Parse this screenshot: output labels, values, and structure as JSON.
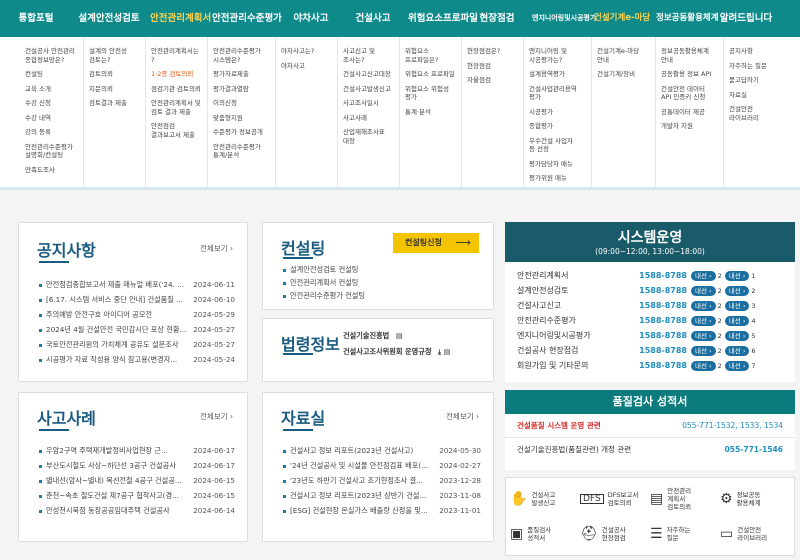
{
  "topnav": [
    "통합포털",
    "설계안전성검토",
    "안전관리계획서",
    "안전관리수준평가",
    "야차사고",
    "건설사고",
    "위험요소프로파일",
    "현장점검",
    "엔지니어링및시공평가",
    "건설기계e-마당",
    "정보공동활용체계",
    "알려드립니다"
  ],
  "mega": [
    [
      "건설공사 안전관리\n종합정보망은?",
      "컨설팅",
      "교육 소개",
      "수강 신청",
      "수강 내역",
      "강의 등록",
      "안전관리수준평가\n설명회/컨설팅",
      "만족도조사"
    ],
    [
      "설계의 안전성\n검토는?",
      "검토의뢰",
      "지문의뢰",
      "검토결과 제출"
    ],
    [
      "안전관리계획서는\n?",
      "1·2종 검토의뢰",
      "점검기관 검토의뢰",
      "안전관리계획서 및\n검토 결과 제출",
      "안전점검\n결과보고서 제출"
    ],
    [
      "안전관리수준평가\n시스템은?",
      "평가자료제출",
      "평가결과열람",
      "이의신청",
      "맞춤형지원",
      "수준평가 정보공개",
      "안전관리수준평가\n통계/분석"
    ],
    [
      "야차사고는?",
      "야차사고"
    ],
    [
      "사고신고 및\n조사는?",
      "건설사고신고대장",
      "건설사고발생신고",
      "사고조사일시",
      "사고사례",
      "산업재해조사표\n대장"
    ],
    [
      "위험요소\n프로파일은?",
      "위험요소 프로파일",
      "위험요소 위험성\n평가",
      "통계·분석"
    ],
    [
      "현장점검은?",
      "현장점검",
      "자율점검"
    ],
    [
      "엔지니어링 및\n시공평가는?",
      "설계용역평가",
      "건설사업관리용역\n평가",
      "시공평가",
      "종합평가",
      "우수건설 사업자\n등 선정",
      "평가담당자 매뉴",
      "평가위원 매뉴"
    ],
    [
      "건설기계e-마당\n안내",
      "건설기계/장비"
    ],
    [
      "정보공동활용체계\n안내",
      "공동활용 정보 API",
      "건설안전 데이터\nAPI 인증키 신청",
      "공통데이터 제공",
      "개발자 지원"
    ],
    [
      "공지사항",
      "자주하는 질문",
      "묻고답하기",
      "자료실",
      "건설안전\n라이브러리"
    ]
  ],
  "notice": {
    "title": "공지사항",
    "more": "전체보기 ›",
    "items": [
      {
        "t": "안전점검종합보고서 제출 매뉴얼 배포('24. ...",
        "d": "2024-06-11"
      },
      {
        "t": "[6.17. 시스템 서비스 중단 안내] 건설품질 ...",
        "d": "2024-06-10"
      },
      {
        "t": "주의예방 안전구호 아이디어 공모전",
        "d": "2024-05-29"
      },
      {
        "t": "2024년 4월 건설안전 국민감시단 포상 현황...",
        "d": "2024-05-27"
      },
      {
        "t": "국토안전관리원의 가치체계 공유도 설문조사",
        "d": "2024-05-27"
      },
      {
        "t": "시공평가 자료 작성용 양식 참고용(변경자...",
        "d": "2024-05-24"
      }
    ]
  },
  "consult": {
    "title": "컨설팅",
    "button": "컨설팅신청",
    "items": [
      "설계안전성검토 컨설팅",
      "안전관리계획서 컨설팅",
      "안전관리수준평가 컨설팅"
    ]
  },
  "law": {
    "title": "법령정보",
    "items": [
      "건설기술진흥법",
      "건설사고조사위원회 운영규정"
    ]
  },
  "cases": {
    "title": "사고사례",
    "more": "전체보기 ›",
    "items": [
      {
        "t": "우암2구역 주택재개발정비사업현장 근...",
        "d": "2024-06-17"
      },
      {
        "t": "부산도시철도 사상~하단선 3공구 건설공사",
        "d": "2024-06-17"
      },
      {
        "t": "별내선(암사~별내) 복선전철 4공구 건설공...",
        "d": "2024-06-15"
      },
      {
        "t": "춘천~속초 철도건설 제7공구 협착사고(경...",
        "d": "2024-06-15"
      },
      {
        "t": "안성천시북점 동장공공임대주택 건설공사",
        "d": "2024-06-14"
      }
    ]
  },
  "library": {
    "title": "자료실",
    "more": "전체보기 ›",
    "items": [
      {
        "t": "건설사고 정보 리포트(2023년 건설사고)",
        "d": "2024-05-30"
      },
      {
        "t": "'24년 건설공사 및 시설물 안전점검표 배포(...",
        "d": "2024-02-27"
      },
      {
        "t": "'23년도 하반기 건설사고 조기현정조사 결...",
        "d": "2023-12-28"
      },
      {
        "t": "건설사고 정보 리포트(2023년 상반기 건설...",
        "d": "2023-11-08"
      },
      {
        "t": "[ESG] 건설현장 온실가스 배출량 산정을 및...",
        "d": "2023-11-01"
      }
    ]
  },
  "system": {
    "title": "시스템운영",
    "hours": "(09:00~12:00, 13:00~18:00)",
    "phone": "1588-8788",
    "btn": "내선",
    "rows": [
      {
        "n": "안전관리계획서",
        "e1": "2",
        "e2": "1"
      },
      {
        "n": "설계안전성검토",
        "e1": "2",
        "e2": "2"
      },
      {
        "n": "건설사고신고",
        "e1": "2",
        "e2": "3"
      },
      {
        "n": "안전관리수준평가",
        "e1": "2",
        "e2": "4"
      },
      {
        "n": "엔지니어링및시공평가",
        "e1": "2",
        "e2": "5"
      },
      {
        "n": "건설공사 현장점검",
        "e1": "2",
        "e2": "6"
      },
      {
        "n": "회원가입 및 기타문의",
        "e1": "2",
        "e2": "7"
      }
    ]
  },
  "quality": {
    "title": "품질검사 성적서",
    "rows": [
      {
        "n": "건설품질 시스템 운영 관련",
        "v": "055-771-1532, 1533, 1534"
      },
      {
        "n": "건설기술진흥법(품질관련) 개정 관련",
        "v": "055-771-1546"
      }
    ]
  },
  "quick": [
    {
      "icon": "hand-icon",
      "label": "건설사고\n발생신고"
    },
    {
      "icon": "dfs-icon",
      "label": "DFS보고서\n검토의뢰"
    },
    {
      "icon": "document-icon",
      "label": "안전관리\n계획서\n검토의뢰"
    },
    {
      "icon": "network-icon",
      "label": "정보공동\n활용체계"
    },
    {
      "icon": "clipboard-icon",
      "label": "품질검사\n성적서"
    },
    {
      "icon": "helmet-icon",
      "label": "건설공사\n현장점검"
    },
    {
      "icon": "faq-icon",
      "label": "자주하는\n질문"
    },
    {
      "icon": "monitor-icon",
      "label": "건설안전\n라이브러리"
    }
  ]
}
